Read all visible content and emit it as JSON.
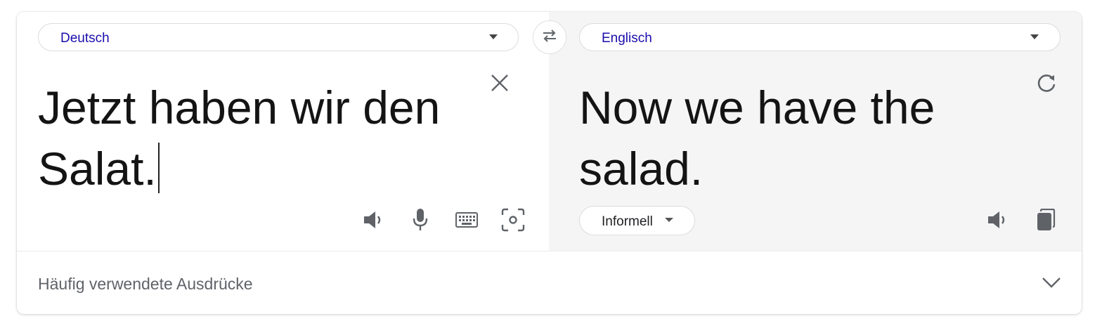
{
  "source": {
    "language": "Deutsch",
    "text": "Jetzt haben wir den Salat."
  },
  "target": {
    "language": "Englisch",
    "text": "Now we have the salad.",
    "formality": "Informell"
  },
  "footer": {
    "phrases_label": "Häufig verwendete Ausdrücke"
  },
  "icons": {
    "swap": "swap-arrows-icon",
    "clear": "close-icon",
    "refresh": "refresh-icon",
    "speaker": "speaker-icon",
    "mic": "microphone-icon",
    "keyboard": "keyboard-icon",
    "camera": "camera-scan-icon",
    "copy": "copy-icon",
    "expand": "chevron-down-icon"
  },
  "colors": {
    "language_link": "#1a0dab",
    "icon_gray": "#5f6368",
    "result_pane_bg": "#f5f5f5"
  }
}
